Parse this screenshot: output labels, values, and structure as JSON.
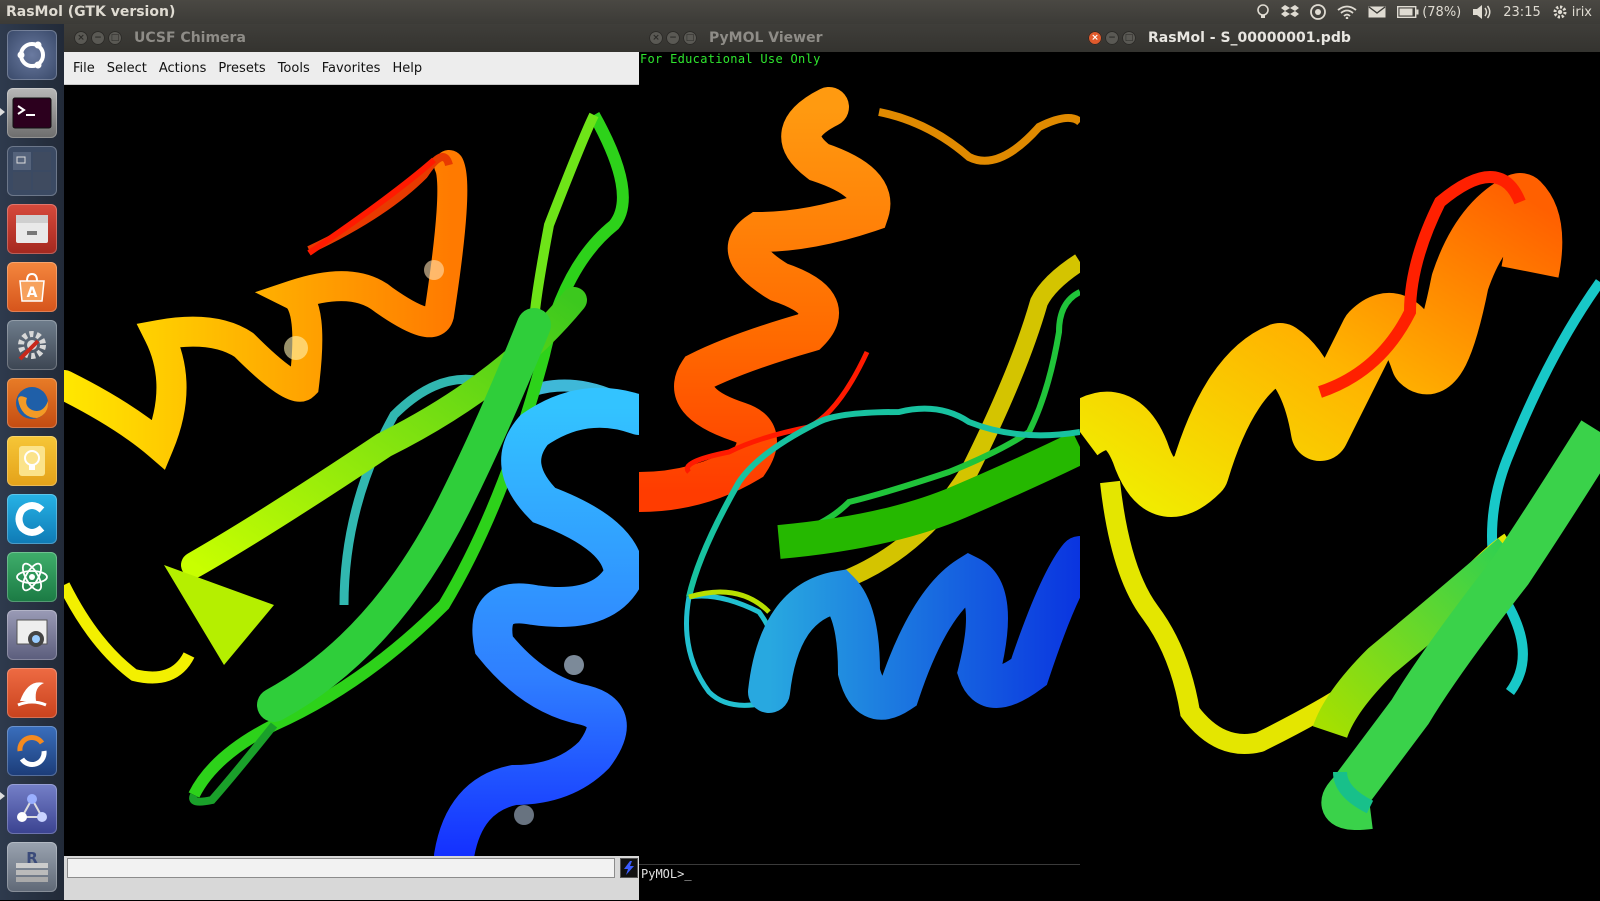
{
  "top_panel": {
    "app_title": "RasMol (GTK version)",
    "battery": "(78%)",
    "time": "23:15",
    "user": "irix",
    "icons": [
      "lightbulb-icon",
      "dropbox-icon",
      "sync-icon",
      "wifi-icon",
      "mail-icon",
      "battery-icon",
      "volume-icon",
      "gear-icon"
    ]
  },
  "launcher": {
    "items": [
      {
        "name": "ubuntu-dash-icon"
      },
      {
        "name": "terminal-icon"
      },
      {
        "name": "workspace-switcher-icon"
      },
      {
        "name": "file-manager-icon"
      },
      {
        "name": "software-center-icon"
      },
      {
        "name": "system-settings-icon"
      },
      {
        "name": "firefox-icon"
      },
      {
        "name": "notes-lightbulb-icon"
      },
      {
        "name": "c-app-icon"
      },
      {
        "name": "atom-icon"
      },
      {
        "name": "webcam-icon"
      },
      {
        "name": "wireshark-fin-icon"
      },
      {
        "name": "sync-app-icon"
      },
      {
        "name": "molecule-icon"
      },
      {
        "name": "r-stack-icon"
      }
    ]
  },
  "windows": {
    "chimera": {
      "title": "UCSF Chimera",
      "menu": [
        "File",
        "Select",
        "Actions",
        "Presets",
        "Tools",
        "Favorites",
        "Help"
      ]
    },
    "pymol": {
      "title": "PyMOL Viewer",
      "notice": "For Educational Use Only",
      "prompt": "PyMOL>_"
    },
    "rasmol": {
      "title": "RasMol - S_00000001.pdb"
    }
  }
}
